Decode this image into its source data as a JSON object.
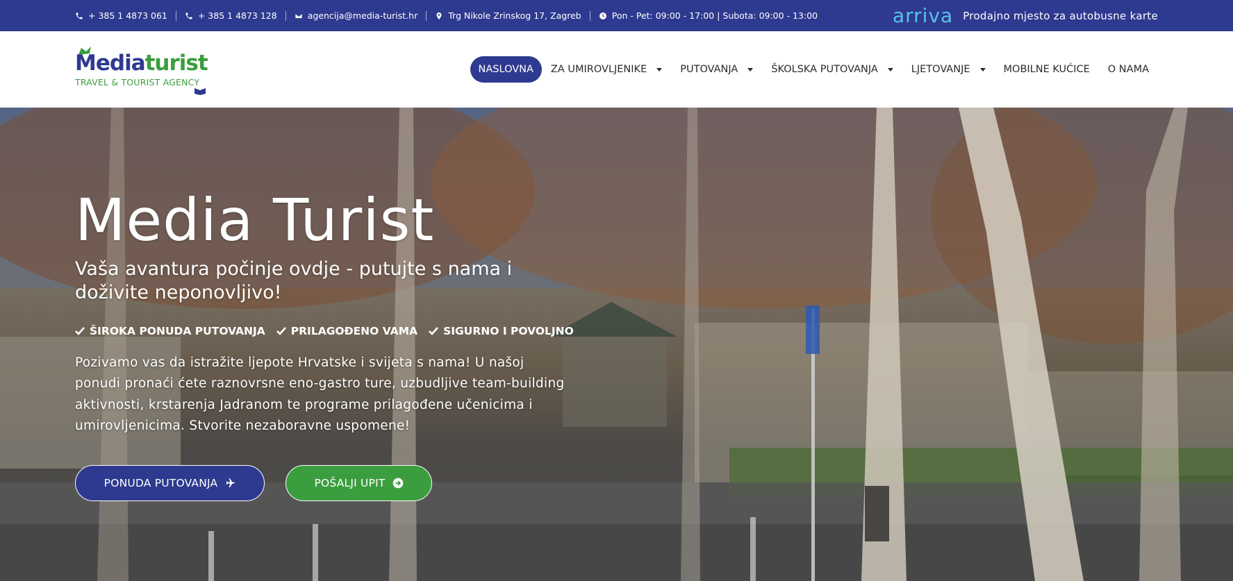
{
  "topbar": {
    "phone1": "+ 385 1 4873 061",
    "phone2": "+ 385 1 4873 128",
    "email": "agencija@media-turist.hr",
    "address": "Trg Nikole Zrinskog 17, Zagreb",
    "hours": "Pon - Pet: 09:00 - 17:00 | Subota: 09:00 - 13:00",
    "partner_logo": "arriva",
    "partner_text": "Prodajno mjesto za autobusne karte"
  },
  "logo": {
    "part1": "Media",
    "part2": "turist",
    "tagline": "TRAVEL & TOURIST AGENCY"
  },
  "nav": {
    "items": [
      {
        "label": "NASLOVNA",
        "dropdown": false,
        "active": true
      },
      {
        "label": "ZA UMIROVLJENIKE",
        "dropdown": true,
        "active": false
      },
      {
        "label": "PUTOVANJA",
        "dropdown": true,
        "active": false
      },
      {
        "label": "ŠKOLSKA PUTOVANJA",
        "dropdown": true,
        "active": false
      },
      {
        "label": "LJETOVANJE",
        "dropdown": true,
        "active": false
      },
      {
        "label": "MOBILNE KUĆICE",
        "dropdown": false,
        "active": false
      },
      {
        "label": "O NAMA",
        "dropdown": false,
        "active": false
      }
    ]
  },
  "hero": {
    "title": "Media Turist",
    "subtitle": "Vaša avantura počinje ovdje - putujte s nama i doživite neponovljivo!",
    "features": [
      "ŠIROKA PONUDA PUTOVANJA",
      "PRILAGOĐENO VAMA",
      "SIGURNO I POVOLJNO"
    ],
    "text": "Pozivamo vas da istražite ljepote Hrvatske i svijeta s nama! U našoj ponudi pronaći ćete raznovrsne eno-gastro ture, uzbudljive team-building aktivnosti, krstarenja Jadranom te programe prilagođene učenicima i umirovljenicima. Stvorite nezaboravne uspomene!",
    "cta_primary": "PONUDA PUTOVANJA",
    "cta_secondary": "POŠALJI UPIT"
  },
  "colors": {
    "brand_blue": "#2e3a8f",
    "brand_green": "#3a9e3f",
    "arriva_cyan": "#59c2e8"
  },
  "icons": {
    "phone": "phone-icon",
    "email": "envelope-icon",
    "address": "map-pin-icon",
    "hours": "clock-icon",
    "check": "check-icon",
    "plane": "plane-icon",
    "arrow": "arrow-circle-right-icon",
    "caret": "caret-down-icon"
  }
}
